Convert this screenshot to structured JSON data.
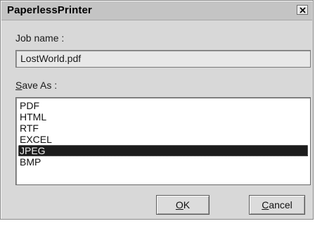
{
  "window": {
    "title": "PaperlessPrinter"
  },
  "icons": {
    "close": "close-icon"
  },
  "job": {
    "label": "Job name :",
    "value": "LostWorld.pdf"
  },
  "save_as": {
    "label_mnemonic": "S",
    "label_rest": "ave As :",
    "options": [
      "PDF",
      "HTML",
      "RTF",
      "EXCEL",
      "JPEG",
      "BMP"
    ],
    "selected": "JPEG"
  },
  "buttons": {
    "ok_mnemonic": "O",
    "ok_rest": "K",
    "cancel_mnemonic": "C",
    "cancel_rest": "ancel"
  }
}
